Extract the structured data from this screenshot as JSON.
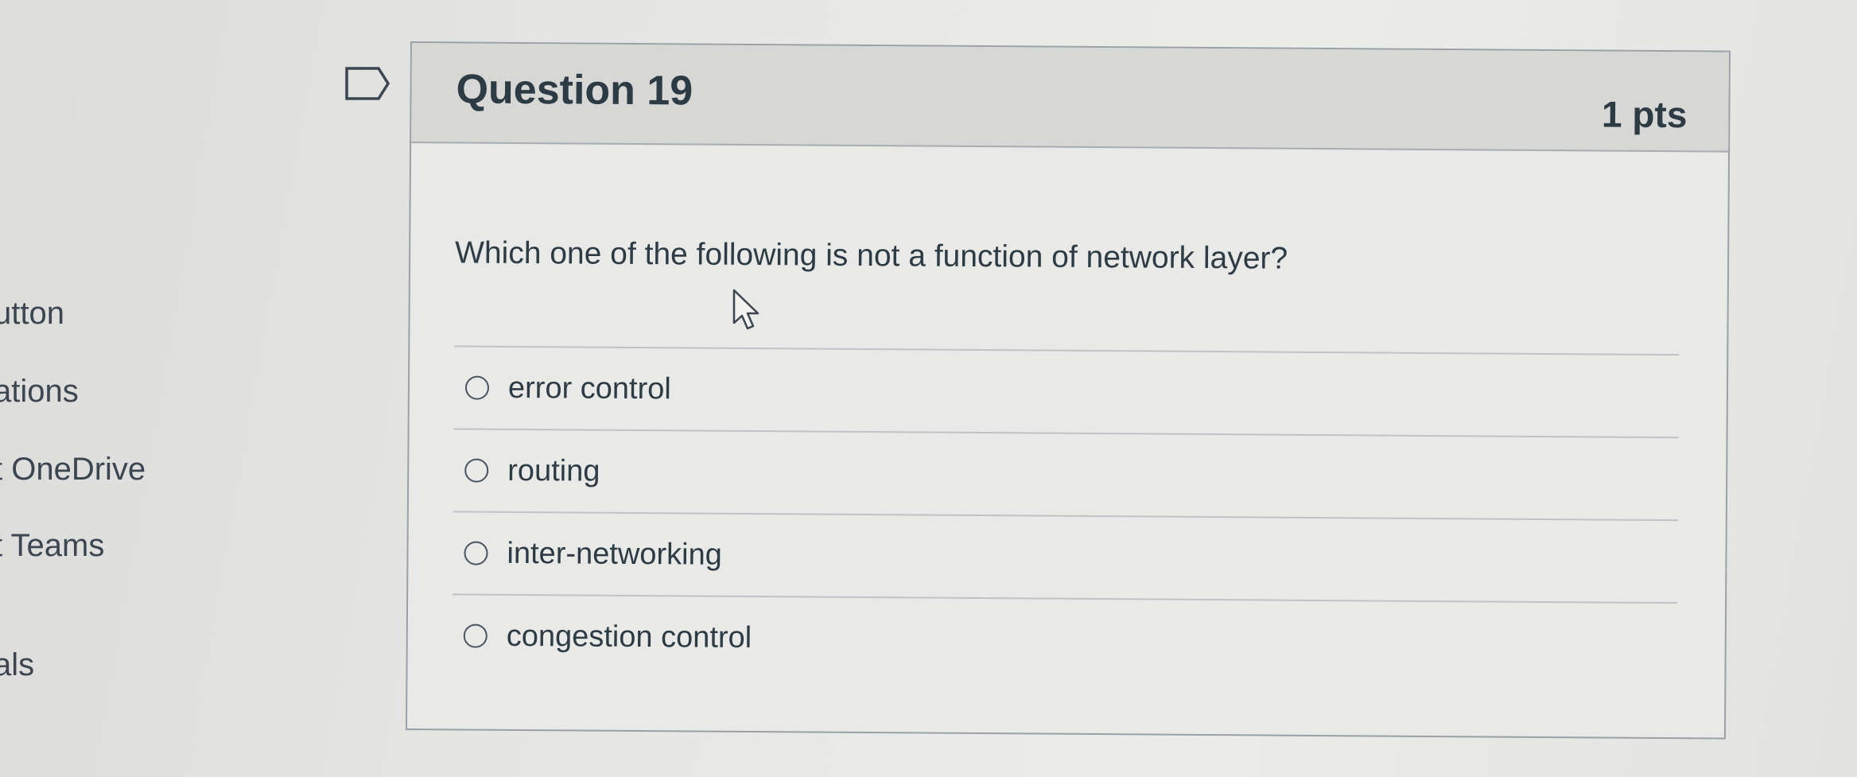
{
  "left_nav": {
    "items": [
      {
        "label": "utton"
      },
      {
        "label": "ations"
      },
      {
        "label": "t OneDrive"
      },
      {
        "label": "t Teams"
      },
      {
        "label": "als"
      }
    ]
  },
  "question": {
    "title": "Question 19",
    "points": "1 pts",
    "text": "Which one of the following is not a function of network layer?",
    "answers": [
      {
        "label": "error control"
      },
      {
        "label": "routing"
      },
      {
        "label": "inter-networking"
      },
      {
        "label": "congestion control"
      }
    ]
  },
  "icons": {
    "flag": "flag-icon",
    "cursor": "mouse-pointer-icon"
  }
}
